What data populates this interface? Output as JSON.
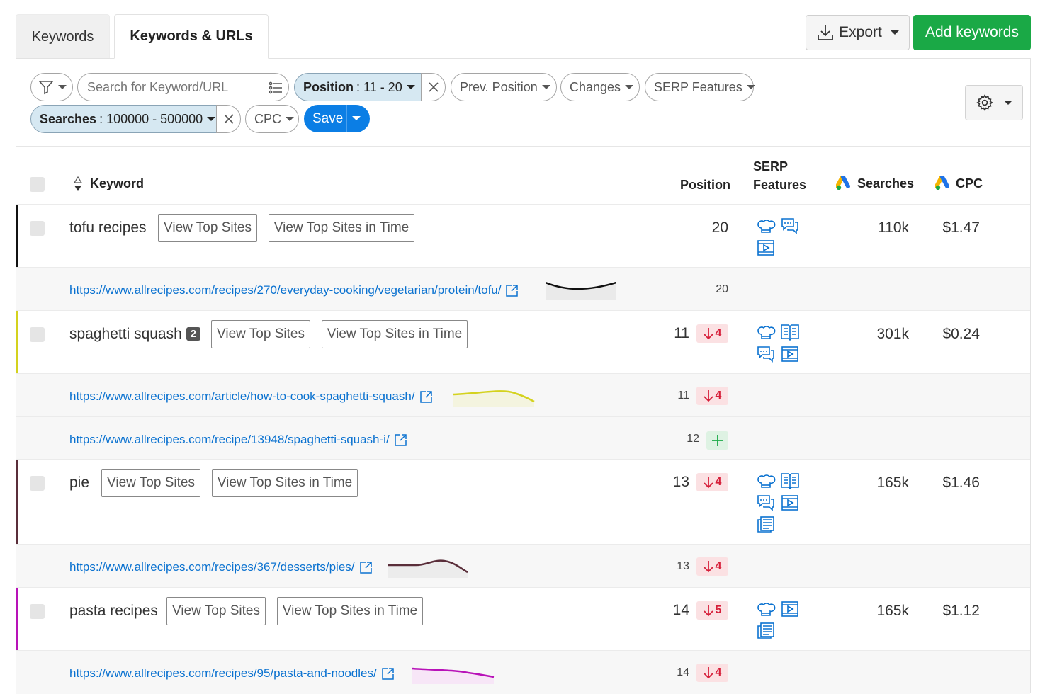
{
  "tabs": {
    "keywords": "Keywords",
    "keywords_urls": "Keywords & URLs"
  },
  "toolbar": {
    "export": "Export",
    "add_keywords": "Add keywords"
  },
  "filters": {
    "search_placeholder": "Search for Keyword/URL",
    "position_label": "Position",
    "position_value": ": 11 - 20",
    "prev_position": "Prev. Position",
    "changes": "Changes",
    "serp_features": "SERP Features",
    "searches_label": "Searches",
    "searches_value": ": 100000 - 500000",
    "cpc": "CPC",
    "save": "Save"
  },
  "columns": {
    "keyword": "Keyword",
    "position": "Position",
    "serp_line1": "SERP",
    "serp_line2": "Features",
    "searches": "Searches",
    "cpc": "CPC"
  },
  "buttons": {
    "view_top_sites": "View Top Sites",
    "view_top_sites_time": "View Top Sites in Time"
  },
  "colors": {
    "accent_green": "#1aa946",
    "accent_blue": "#0b7ee5",
    "link_blue": "#0b72d0",
    "down_red": "#d61f3a"
  },
  "rows": [
    {
      "keyword": "tofu recipes",
      "badge": "",
      "position": "20",
      "change": "",
      "searches": "110k",
      "cpc": "$1.47",
      "color": "#111111",
      "serp": [
        "chef-hat-icon",
        "comments-icon",
        "video-icon"
      ],
      "urls": [
        {
          "url": "https://www.allrecipes.com/recipes/270/everyday-cooking/vegetarian/protein/tofu/",
          "position": "20",
          "change": ""
        }
      ]
    },
    {
      "keyword": "spaghetti squash",
      "badge": "2",
      "position": "11",
      "change": "4",
      "searches": "301k",
      "cpc": "$0.24",
      "color": "#d4d21e",
      "serp": [
        "chef-hat-icon",
        "book-icon",
        "comments-icon",
        "video-icon"
      ],
      "urls": [
        {
          "url": "https://www.allrecipes.com/article/how-to-cook-spaghetti-squash/",
          "position": "11",
          "change": "4"
        },
        {
          "url": "https://www.allrecipes.com/recipe/13948/spaghetti-squash-i/",
          "position": "12",
          "change": "new"
        }
      ]
    },
    {
      "keyword": "pie",
      "badge": "",
      "position": "13",
      "change": "4",
      "searches": "165k",
      "cpc": "$1.46",
      "color": "#5a2e3a",
      "serp": [
        "chef-hat-icon",
        "book-icon",
        "comments-icon",
        "video-icon",
        "news-icon"
      ],
      "urls": [
        {
          "url": "https://www.allrecipes.com/recipes/367/desserts/pies/",
          "position": "13",
          "change": "4"
        }
      ]
    },
    {
      "keyword": "pasta recipes",
      "badge": "",
      "position": "14",
      "change": "5",
      "searches": "165k",
      "cpc": "$1.12",
      "color": "#b812b8",
      "serp": [
        "chef-hat-icon",
        "video-icon",
        "news-icon"
      ],
      "urls": [
        {
          "url": "https://www.allrecipes.com/recipes/95/pasta-and-noodles/",
          "position": "14",
          "change": "4"
        }
      ]
    }
  ]
}
